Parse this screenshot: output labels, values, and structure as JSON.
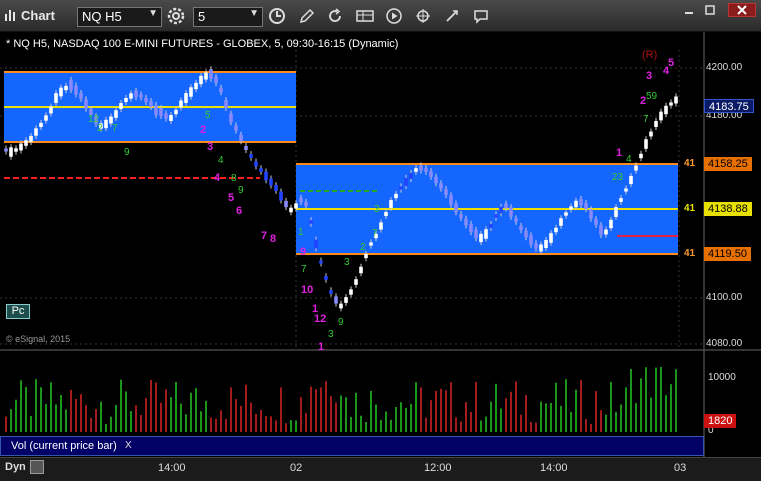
{
  "window": {
    "title": "Chart",
    "symbol": "NQ H5",
    "interval": "5",
    "icons": [
      "clock-icon",
      "gear-icon",
      "pencil-icon",
      "cursor-icon",
      "cnr-icon",
      "play-icon",
      "link-icon",
      "crosshair-icon",
      "chat-icon"
    ],
    "window_buttons": [
      "minimize-icon",
      "restore-icon",
      "close-icon"
    ]
  },
  "chart": {
    "header": "* NQ H5, NASDAQ 100 E-MINI FUTURES - GLOBEX, 5, 09:30-16:15 (Dynamic)",
    "watermark": "© eSignal, 2015",
    "pc_label": "Pc",
    "r_marker": "(R)",
    "price_axis": [
      "4200.00",
      "4180.00",
      "4100.00",
      "4080.00"
    ],
    "price_tags": [
      {
        "label": "4183.75",
        "color": "#0a1a66"
      },
      {
        "label": "4158.25",
        "color": "#e87000"
      },
      {
        "label": "4138.88",
        "color": "#e8e000"
      },
      {
        "label": "4119.50",
        "color": "#e87000"
      }
    ],
    "level_stubs": [
      "41",
      "41",
      "41"
    ]
  },
  "volume": {
    "title": "Vol (current price bar)",
    "close": "X",
    "axis": [
      "10000",
      "0"
    ],
    "current": "1820"
  },
  "time_axis": {
    "mode": "Dyn",
    "labels": [
      "14:00",
      "02",
      "12:00",
      "14:00",
      "03"
    ]
  }
}
